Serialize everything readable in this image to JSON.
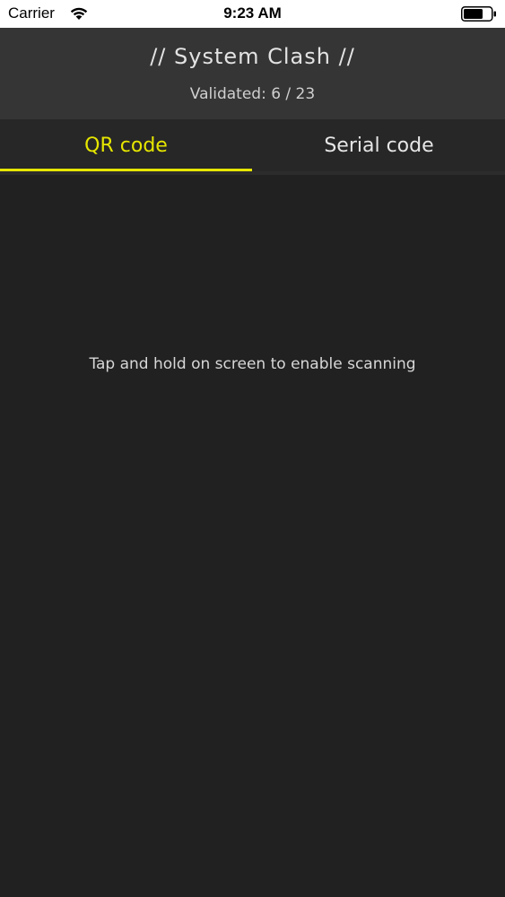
{
  "status_bar": {
    "carrier": "Carrier",
    "time": "9:23 AM",
    "icons": [
      "wifi-icon",
      "battery-icon"
    ]
  },
  "header": {
    "title": "// System Clash //",
    "validated": "Validated: 6 / 23"
  },
  "tabs": [
    {
      "label": "QR code",
      "active": true
    },
    {
      "label": "Serial code",
      "active": false
    }
  ],
  "content": {
    "hint": "Tap and hold on screen to enable scanning"
  },
  "colors": {
    "accent": "#e6e600",
    "background": "#212121",
    "header": "#353535"
  }
}
